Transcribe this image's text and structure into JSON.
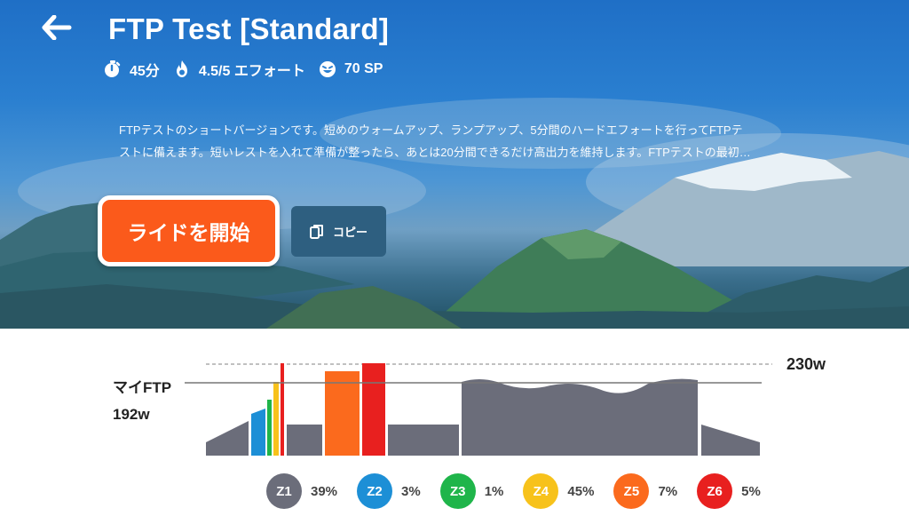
{
  "header": {
    "title": "FTP Test [Standard]",
    "duration": "45分",
    "effort": "4.5/5 エフォート",
    "sp": "70 SP"
  },
  "description": {
    "line1": "FTPテストのショートバージョンです。短めのウォームアップ、ランプアップ、5分間のハードエフォートを行ってFTPテ",
    "line2": "ストに備えます。短いレストを入れて準備が整ったら、あとは20分間できるだけ高出力を維持します。FTPテストの最初…"
  },
  "actions": {
    "ride_label": "ライドを開始",
    "copy_label": "コピー"
  },
  "chart": {
    "ftp_title": "マイFTP",
    "ftp_value": "192w",
    "max_value": "230w"
  },
  "zones": [
    {
      "label": "Z1",
      "pct": "39%",
      "color": "#6b6d7a"
    },
    {
      "label": "Z2",
      "pct": "3%",
      "color": "#1d8fd6"
    },
    {
      "label": "Z3",
      "pct": "1%",
      "color": "#1fb54a"
    },
    {
      "label": "Z4",
      "pct": "45%",
      "color": "#f7c21b"
    },
    {
      "label": "Z5",
      "pct": "7%",
      "color": "#fb6a1d"
    },
    {
      "label": "Z6",
      "pct": "5%",
      "color": "#e8201f"
    }
  ],
  "icons": {
    "back": "arrow-left-icon",
    "duration": "stopwatch-icon",
    "effort": "flame-icon",
    "sp": "grin-face-icon",
    "copy": "copy-icon"
  },
  "colors": {
    "accent": "#fb5a1b",
    "copy_button": "#2e5f80",
    "workout_gray": "#6b6d7a"
  }
}
